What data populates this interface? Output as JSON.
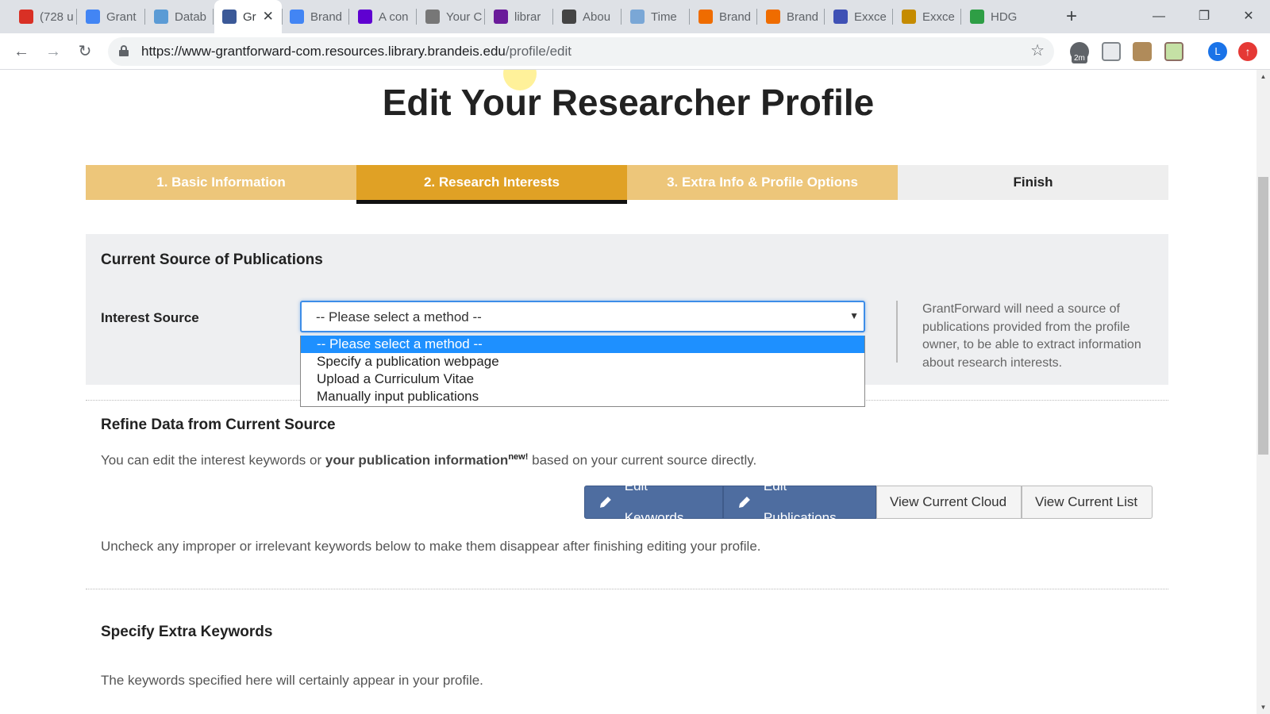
{
  "browser": {
    "tabs": [
      {
        "title": "(728 u",
        "icon": "mail-icon",
        "color": "#d93025"
      },
      {
        "title": "Grant",
        "icon": "docs-icon",
        "color": "#4285f4"
      },
      {
        "title": "Datab",
        "icon": "cloud-icon",
        "color": "#5b9bd5"
      },
      {
        "title": "Gr",
        "icon": "grantforward-icon",
        "color": "#3b5998",
        "active": true
      },
      {
        "title": "Brand",
        "icon": "calendar-icon",
        "color": "#4285f4"
      },
      {
        "title": "A con",
        "icon": "yahoo-icon",
        "color": "#5f01d1"
      },
      {
        "title": "Your C",
        "icon": "glasses-icon",
        "color": "#777777"
      },
      {
        "title": "librar",
        "icon": "library-icon",
        "color": "#6a1b9a"
      },
      {
        "title": "Abou",
        "icon": "face-icon",
        "color": "#444444"
      },
      {
        "title": "Time",
        "icon": "clock-icon",
        "color": "#7aa7d6"
      },
      {
        "title": "Brand",
        "icon": "question-icon",
        "color": "#ef6c00"
      },
      {
        "title": "Brand",
        "icon": "question-icon",
        "color": "#ef6c00"
      },
      {
        "title": "Exxce",
        "icon": "dots-icon",
        "color": "#3f51b5"
      },
      {
        "title": "Exxce",
        "icon": "figure-icon",
        "color": "#c58b00"
      },
      {
        "title": "HDG",
        "icon": "person-icon",
        "color": "#2e9e45"
      }
    ],
    "url_host": "https://www-grantforward-com.resources.library.brandeis.edu",
    "url_path": "/profile/edit",
    "badge": "2m",
    "avatar_letter": "L"
  },
  "page": {
    "title": "Edit Your Researcher Profile",
    "steps": [
      {
        "label": "1. Basic Information",
        "state": "done"
      },
      {
        "label": "2. Research Interests",
        "state": "current"
      },
      {
        "label": "3. Extra Info & Profile Options",
        "state": "todo"
      },
      {
        "label": "Finish",
        "state": "finish"
      }
    ],
    "source": {
      "heading": "Current Source of Publications",
      "label": "Interest Source",
      "selected": "-- Please select a method --",
      "options": [
        "-- Please select a method --",
        "Specify a publication webpage",
        "Upload a Curriculum Vitae",
        "Manually input publications"
      ],
      "help": "GrantForward will need a source of publications provided from the profile owner, to be able to extract information about research interests."
    },
    "refine": {
      "heading": "Refine Data from Current Source",
      "text_before": "You can edit the interest keywords or ",
      "text_bold": "your publication information",
      "text_sup": "new!",
      "text_after": " based on your current source directly.",
      "buttons": {
        "edit_keywords": "Edit Keywords",
        "edit_publications": "Edit Publications",
        "view_cloud": "View Current Cloud",
        "view_list": "View Current List"
      },
      "uncheck_note": "Uncheck any improper or irrelevant keywords below to make them disappear after finishing editing your profile."
    },
    "extra": {
      "heading": "Specify Extra Keywords",
      "text": "The keywords specified here will certainly appear in your profile."
    }
  },
  "colors": {
    "step_light": "#edc67a",
    "step_active": "#e0a125",
    "primary_button": "#4e6da0",
    "dropdown_highlight": "#1e90ff"
  }
}
